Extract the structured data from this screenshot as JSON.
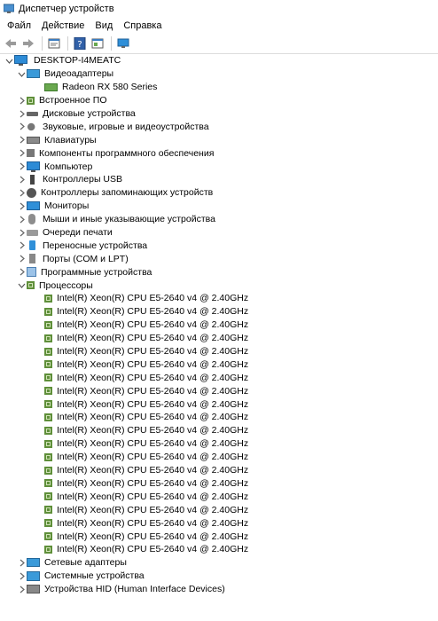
{
  "window": {
    "title": "Диспетчер устройств"
  },
  "menu": [
    "Файл",
    "Действие",
    "Вид",
    "Справка"
  ],
  "toolbar": {
    "icons": [
      "back-arrow-icon",
      "forward-arrow-icon",
      "properties-icon",
      "help-icon",
      "update-driver-icon",
      "monitor-icon"
    ]
  },
  "tree": {
    "root": {
      "label": "DESKTOP-I4MEATC",
      "icon": "computer-icon"
    },
    "categories": [
      {
        "label": "Видеоадаптеры",
        "icon": "display-adapter-icon",
        "expanded": true
      },
      {
        "label": "Встроенное ПО",
        "icon": "firmware-icon",
        "expanded": false
      },
      {
        "label": "Дисковые устройства",
        "icon": "disk-drive-icon",
        "expanded": false
      },
      {
        "label": "Звуковые, игровые и видеоустройства",
        "icon": "sound-icon",
        "expanded": false
      },
      {
        "label": "Клавиатуры",
        "icon": "keyboard-icon",
        "expanded": false
      },
      {
        "label": "Компоненты программного обеспечения",
        "icon": "software-component-icon",
        "expanded": false
      },
      {
        "label": "Компьютер",
        "icon": "computer-icon",
        "expanded": false
      },
      {
        "label": "Контроллеры USB",
        "icon": "usb-icon",
        "expanded": false
      },
      {
        "label": "Контроллеры запоминающих устройств",
        "icon": "storage-controller-icon",
        "expanded": false
      },
      {
        "label": "Мониторы",
        "icon": "monitor-icon",
        "expanded": false
      },
      {
        "label": "Мыши и иные указывающие устройства",
        "icon": "mouse-icon",
        "expanded": false
      },
      {
        "label": "Очереди печати",
        "icon": "printer-icon",
        "expanded": false
      },
      {
        "label": "Переносные устройства",
        "icon": "portable-device-icon",
        "expanded": false
      },
      {
        "label": "Порты (COM и LPT)",
        "icon": "port-icon",
        "expanded": false
      },
      {
        "label": "Программные устройства",
        "icon": "software-device-icon",
        "expanded": false
      },
      {
        "label": "Процессоры",
        "icon": "processor-icon",
        "expanded": true
      },
      {
        "label": "Сетевые адаптеры",
        "icon": "network-adapter-icon",
        "expanded": false
      },
      {
        "label": "Системные устройства",
        "icon": "system-device-icon",
        "expanded": false
      },
      {
        "label": "Устройства HID (Human Interface Devices)",
        "icon": "hid-icon",
        "expanded": false
      }
    ],
    "gpu_device": "Radeon RX 580 Series",
    "processor_device": "Intel(R) Xeon(R) CPU E5-2640 v4 @ 2.40GHz",
    "processor_count": 20
  }
}
